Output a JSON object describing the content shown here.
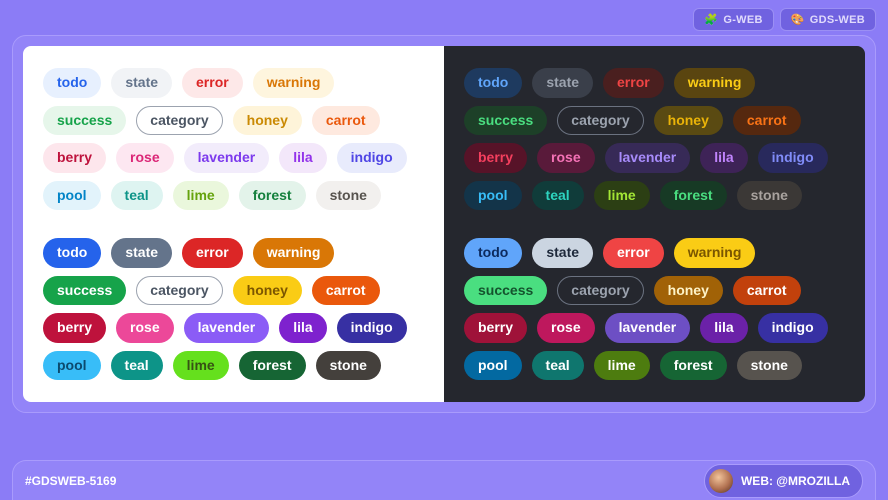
{
  "header": {
    "links": [
      {
        "name": "g-web-link",
        "icon": "🧩",
        "label": "G-WEB"
      },
      {
        "name": "gds-web-link",
        "icon": "🎨",
        "label": "GDS-WEB"
      }
    ]
  },
  "tags": [
    {
      "key": "todo",
      "label": "todo"
    },
    {
      "key": "state",
      "label": "state"
    },
    {
      "key": "error",
      "label": "error"
    },
    {
      "key": "warning",
      "label": "warning"
    },
    {
      "key": "success",
      "label": "success"
    },
    {
      "key": "category",
      "label": "category"
    },
    {
      "key": "honey",
      "label": "honey"
    },
    {
      "key": "carrot",
      "label": "carrot"
    },
    {
      "key": "berry",
      "label": "berry"
    },
    {
      "key": "rose",
      "label": "rose"
    },
    {
      "key": "lavender",
      "label": "lavender"
    },
    {
      "key": "lila",
      "label": "lila"
    },
    {
      "key": "indigo",
      "label": "indigo"
    },
    {
      "key": "pool",
      "label": "pool"
    },
    {
      "key": "teal",
      "label": "teal"
    },
    {
      "key": "lime",
      "label": "lime"
    },
    {
      "key": "forest",
      "label": "forest"
    },
    {
      "key": "stone",
      "label": "stone"
    }
  ],
  "palette": {
    "light": {
      "soft": {
        "todo": {
          "bg": "#e7f0fe",
          "fg": "#2563eb"
        },
        "state": {
          "bg": "#f1f3f6",
          "fg": "#64748b"
        },
        "error": {
          "bg": "#fde8e8",
          "fg": "#dc2626"
        },
        "warning": {
          "bg": "#fef5de",
          "fg": "#d97706"
        },
        "success": {
          "bg": "#e6f6ea",
          "fg": "#16a34a"
        },
        "category": {
          "bg": "#ffffff",
          "fg": "#4b5563",
          "border": "#9ca3af"
        },
        "honey": {
          "bg": "#fef4d9",
          "fg": "#ca8a04"
        },
        "carrot": {
          "bg": "#fee9df",
          "fg": "#ea580c"
        },
        "berry": {
          "bg": "#fde6ec",
          "fg": "#be123c"
        },
        "rose": {
          "bg": "#fde7f1",
          "fg": "#db2777"
        },
        "lavender": {
          "bg": "#f2ecfb",
          "fg": "#7c3aed"
        },
        "lila": {
          "bg": "#f3e7fa",
          "fg": "#9333ea"
        },
        "indigo": {
          "bg": "#e8ebfc",
          "fg": "#4f46e5"
        },
        "pool": {
          "bg": "#e2f3fb",
          "fg": "#0284c7"
        },
        "teal": {
          "bg": "#def4f1",
          "fg": "#0d9488"
        },
        "lime": {
          "bg": "#eaf7dc",
          "fg": "#65a30d"
        },
        "forest": {
          "bg": "#e3f3ea",
          "fg": "#15803d"
        },
        "stone": {
          "bg": "#f2f0ee",
          "fg": "#57534e"
        }
      },
      "solid": {
        "todo": {
          "bg": "#2563eb",
          "fg": "#ffffff"
        },
        "state": {
          "bg": "#64748b",
          "fg": "#ffffff"
        },
        "error": {
          "bg": "#dc2626",
          "fg": "#ffffff"
        },
        "warning": {
          "bg": "#d97706",
          "fg": "#ffffff"
        },
        "success": {
          "bg": "#16a34a",
          "fg": "#ffffff"
        },
        "category": {
          "bg": "#ffffff",
          "fg": "#4b5563",
          "border": "#9ca3af"
        },
        "honey": {
          "bg": "#facc15",
          "fg": "#7c5600"
        },
        "carrot": {
          "bg": "#ea580c",
          "fg": "#ffffff"
        },
        "berry": {
          "bg": "#be123c",
          "fg": "#ffffff"
        },
        "rose": {
          "bg": "#ec4899",
          "fg": "#ffffff"
        },
        "lavender": {
          "bg": "#8b5cf6",
          "fg": "#ffffff"
        },
        "lila": {
          "bg": "#7e22ce",
          "fg": "#ffffff"
        },
        "indigo": {
          "bg": "#3730a3",
          "fg": "#ffffff"
        },
        "pool": {
          "bg": "#38bdf8",
          "fg": "#0c4a6e"
        },
        "teal": {
          "bg": "#0d9488",
          "fg": "#ffffff"
        },
        "lime": {
          "bg": "#65e01d",
          "fg": "#365314"
        },
        "forest": {
          "bg": "#166534",
          "fg": "#ffffff"
        },
        "stone": {
          "bg": "#44403c",
          "fg": "#ffffff"
        }
      }
    },
    "dark": {
      "soft": {
        "todo": {
          "bg": "#1e3a5f",
          "fg": "#60a5fa"
        },
        "state": {
          "bg": "#3a3f4a",
          "fg": "#9ca3af"
        },
        "error": {
          "bg": "#4a1f1f",
          "fg": "#ef4444"
        },
        "warning": {
          "bg": "#5a4510",
          "fg": "#facc15"
        },
        "success": {
          "bg": "#1d4028",
          "fg": "#4ade80"
        },
        "category": {
          "bg": "#25272e",
          "fg": "#9ca3af",
          "border": "#6b7280"
        },
        "honey": {
          "bg": "#5a4a12",
          "fg": "#eab308"
        },
        "carrot": {
          "bg": "#55280f",
          "fg": "#f97316"
        },
        "berry": {
          "bg": "#571328",
          "fg": "#f43f5e"
        },
        "rose": {
          "bg": "#591a3a",
          "fg": "#f472b6"
        },
        "lavender": {
          "bg": "#372a57",
          "fg": "#a78bfa"
        },
        "lila": {
          "bg": "#3e2357",
          "fg": "#c084fc"
        },
        "indigo": {
          "bg": "#28295c",
          "fg": "#818cf8"
        },
        "pool": {
          "bg": "#133449",
          "fg": "#38bdf8"
        },
        "teal": {
          "bg": "#103c3a",
          "fg": "#2dd4bf"
        },
        "lime": {
          "bg": "#2c3f14",
          "fg": "#a3e635"
        },
        "forest": {
          "bg": "#173a25",
          "fg": "#4ade80"
        },
        "stone": {
          "bg": "#3b3836",
          "fg": "#a8a29e"
        }
      },
      "solid": {
        "todo": {
          "bg": "#60a5fa",
          "fg": "#0c2a5e"
        },
        "state": {
          "bg": "#cbd5e1",
          "fg": "#1e293b"
        },
        "error": {
          "bg": "#ef4444",
          "fg": "#ffffff"
        },
        "warning": {
          "bg": "#facc15",
          "fg": "#7a5600"
        },
        "success": {
          "bg": "#4ade80",
          "fg": "#14532d"
        },
        "category": {
          "bg": "#25272e",
          "fg": "#9ca3af",
          "border": "#6b7280"
        },
        "honey": {
          "bg": "#a16207",
          "fg": "#fef3c7"
        },
        "carrot": {
          "bg": "#c2410c",
          "fg": "#ffffff"
        },
        "berry": {
          "bg": "#9f1239",
          "fg": "#ffffff"
        },
        "rose": {
          "bg": "#be185d",
          "fg": "#ffffff"
        },
        "lavender": {
          "bg": "#6d4fc4",
          "fg": "#ffffff"
        },
        "lila": {
          "bg": "#6b21a8",
          "fg": "#ffffff"
        },
        "indigo": {
          "bg": "#3730a3",
          "fg": "#ffffff"
        },
        "pool": {
          "bg": "#0369a1",
          "fg": "#ffffff"
        },
        "teal": {
          "bg": "#0f766e",
          "fg": "#ffffff"
        },
        "lime": {
          "bg": "#4d7c0f",
          "fg": "#ffffff"
        },
        "forest": {
          "bg": "#166534",
          "fg": "#ffffff"
        },
        "stone": {
          "bg": "#57534e",
          "fg": "#ffffff"
        }
      }
    }
  },
  "footer": {
    "ticket": "#GDSWEB-5169",
    "author_label": "WEB: @MROZILLA"
  }
}
